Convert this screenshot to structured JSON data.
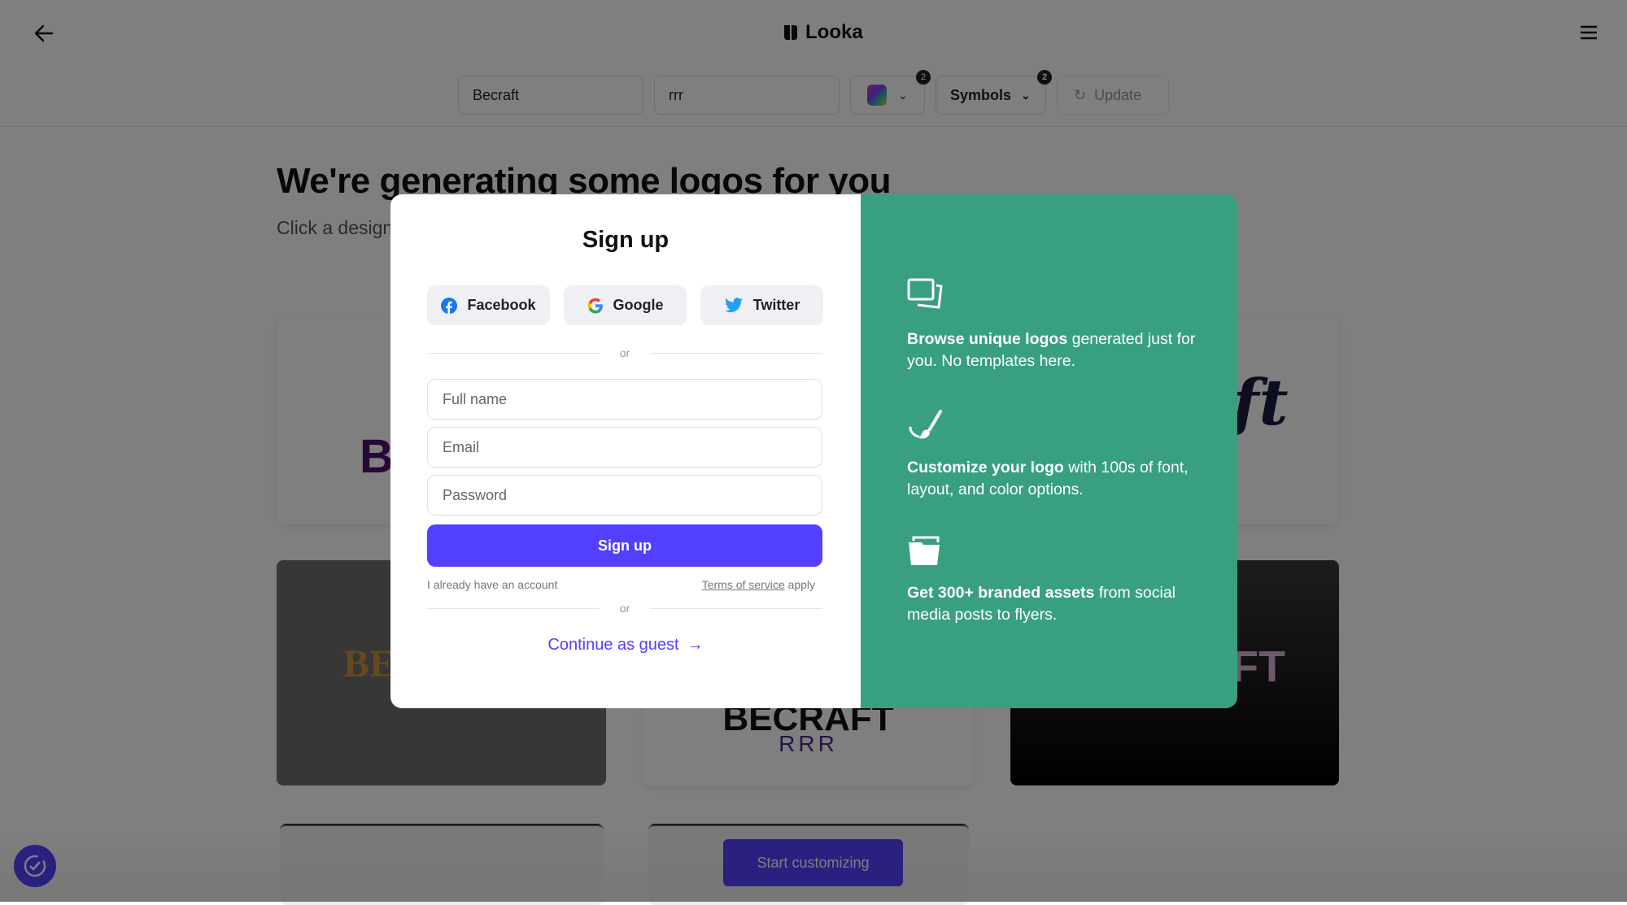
{
  "header": {
    "brand": "Looka",
    "back_icon": "arrow-left-icon",
    "menu_icon": "hamburger-icon"
  },
  "toolbar": {
    "company_name": "Becraft",
    "slogan": "rrr",
    "colors_badge": "2",
    "symbols_label": "Symbols",
    "symbols_badge": "2",
    "update_label": "Update"
  },
  "main": {
    "title": "We're generating some logos for you",
    "subtitle": "Click a design",
    "logos": {
      "card1": "B",
      "card2": "ft",
      "card3": "BE",
      "card4_name": "BECRAFT",
      "card4_slogan": "RRR",
      "card5": "FT"
    },
    "start_button": "Start customizing"
  },
  "modal": {
    "title": "Sign up",
    "social": [
      {
        "label": "Facebook",
        "icon": "facebook-icon"
      },
      {
        "label": "Google",
        "icon": "google-icon"
      },
      {
        "label": "Twitter",
        "icon": "twitter-icon"
      }
    ],
    "or": "or",
    "fields": {
      "full_name_placeholder": "Full name",
      "email_placeholder": "Email",
      "password_placeholder": "Password"
    },
    "submit": "Sign up",
    "have_account": "I already have an account",
    "terms_link": "Terms of service",
    "terms_suffix": " apply",
    "guest": "Continue as guest",
    "features": [
      {
        "icon": "images-icon",
        "bold": "Browse unique logos",
        "text": " generated just for you. No templates here."
      },
      {
        "icon": "paintbrush-icon",
        "bold": "Customize your logo",
        "text": " with 100s of font, layout, and color options."
      },
      {
        "icon": "folder-icon",
        "bold": "Get 300+ branded assets",
        "text": " from social media posts to flyers."
      }
    ],
    "colors": {
      "primary": "#5340ff",
      "green": "#38a080"
    }
  }
}
